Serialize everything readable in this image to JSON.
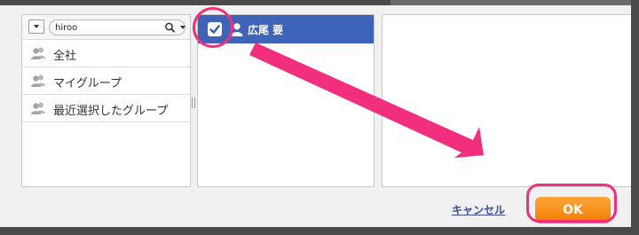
{
  "search": {
    "value": "hiroo"
  },
  "groups": [
    {
      "label": "全社",
      "icon": "users-icon"
    },
    {
      "label": "マイグループ",
      "icon": "users-icon"
    },
    {
      "label": "最近選択したグループ",
      "icon": "users-icon"
    }
  ],
  "results": [
    {
      "name": "広尾 要",
      "checked": true,
      "icon": "user-icon"
    }
  ],
  "footer": {
    "cancel_label": "キャンセル",
    "ok_label": "OK"
  },
  "colors": {
    "selection": "#3f63b9",
    "ok_button": "#f7931e",
    "annotation": "#f12f7d",
    "link": "#3a4f9a"
  }
}
